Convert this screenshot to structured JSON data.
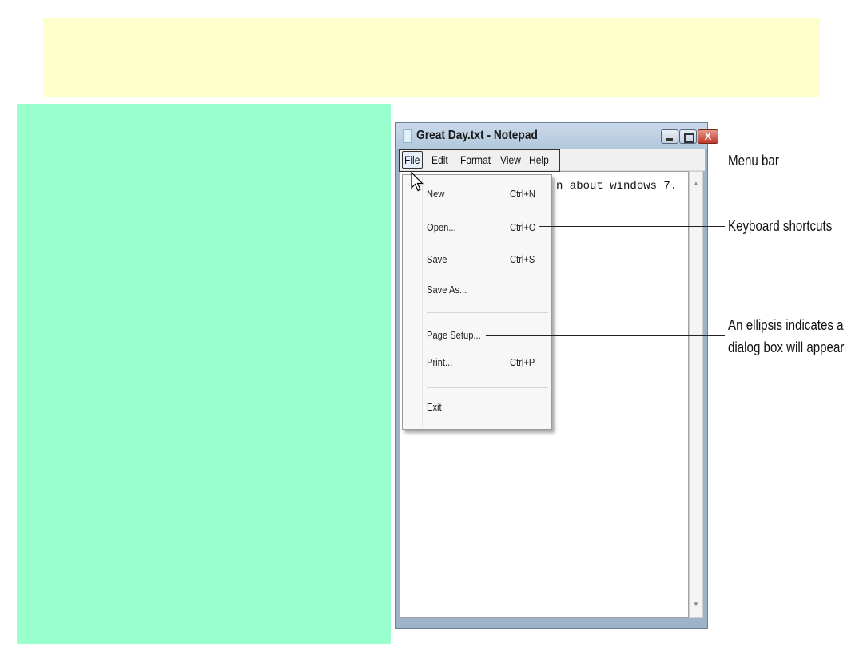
{
  "window": {
    "title": "Great Day.txt - Notepad",
    "close_glyph": "X",
    "buttons": [
      "minimize-icon",
      "maximize-icon",
      "close-icon"
    ]
  },
  "menubar": {
    "items": [
      "File",
      "Edit",
      "Format",
      "View",
      "Help"
    ]
  },
  "editor": {
    "visible_text": "n about windows 7."
  },
  "file_menu": {
    "items": [
      {
        "label": "New",
        "shortcut": "Ctrl+N"
      },
      {
        "label": "Open...",
        "shortcut": "Ctrl+O"
      },
      {
        "label": "Save",
        "shortcut": "Ctrl+S"
      },
      {
        "label": "Save As...",
        "shortcut": ""
      },
      {
        "label": "Page Setup...",
        "shortcut": ""
      },
      {
        "label": "Print...",
        "shortcut": "Ctrl+P"
      },
      {
        "label": "Exit",
        "shortcut": ""
      }
    ]
  },
  "callouts": {
    "menu_bar": "Menu bar",
    "keyboard_shortcuts": "Keyboard shortcuts",
    "ellipsis_line1": "An ellipsis indicates a",
    "ellipsis_line2": "dialog box will appear"
  },
  "colors": {
    "title_band": "#ffffcc",
    "left_panel": "#99ffcc"
  }
}
